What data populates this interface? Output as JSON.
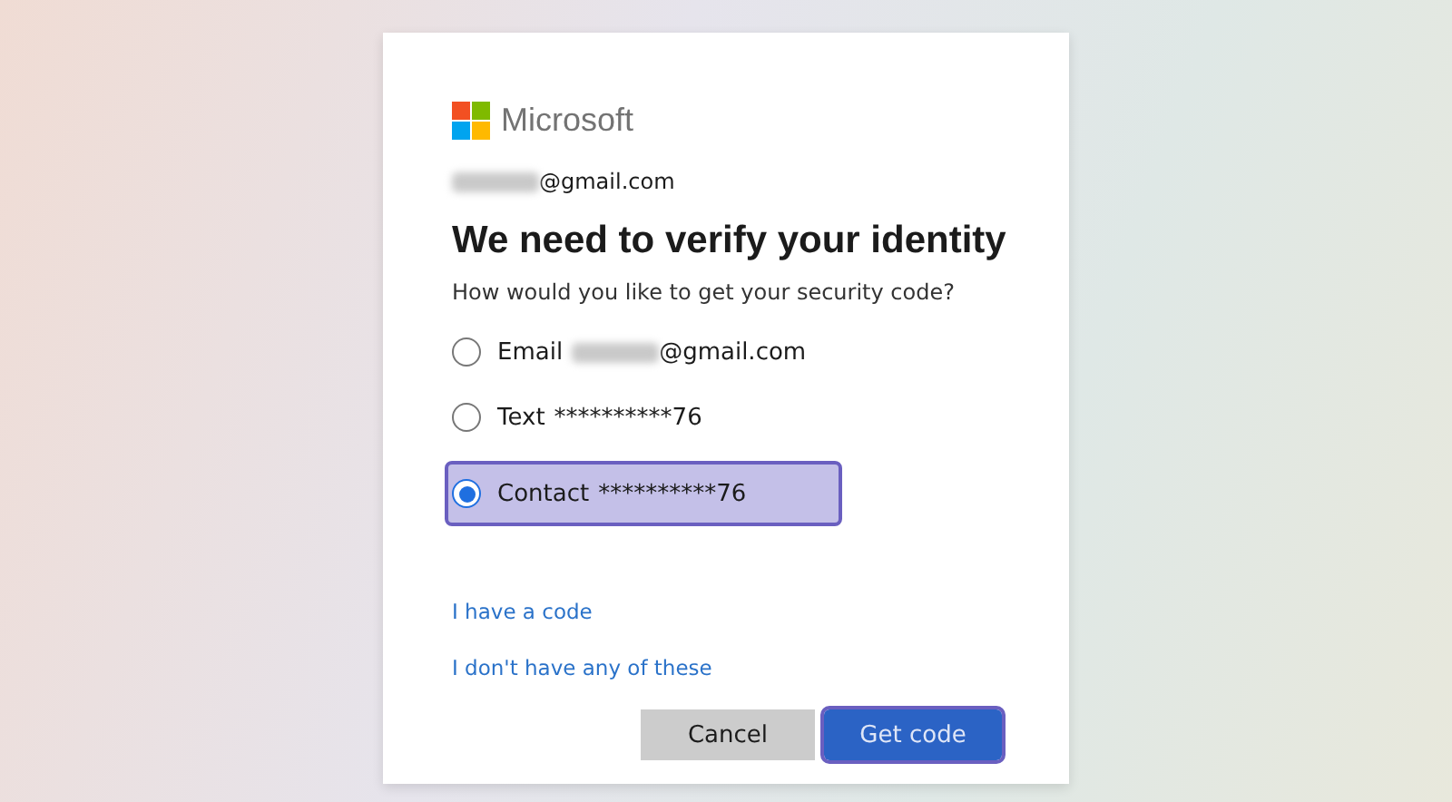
{
  "brand": {
    "name": "Microsoft"
  },
  "account": {
    "redacted": true,
    "suffix": "@gmail.com"
  },
  "title": "We need to verify your identity",
  "prompt": "How would you like to get your security code?",
  "options": [
    {
      "label": "Email",
      "redacted": true,
      "detail": "@gmail.com",
      "selected": false,
      "highlighted": false
    },
    {
      "label": "Text",
      "redacted": false,
      "detail": "**********76",
      "selected": false,
      "highlighted": false
    },
    {
      "label": "Contact",
      "redacted": false,
      "detail": "**********76",
      "selected": true,
      "highlighted": true
    }
  ],
  "links": [
    "I have a code",
    "I don't have any of these"
  ],
  "buttons": [
    {
      "label": "Cancel",
      "kind": "secondary",
      "highlighted": false
    },
    {
      "label": "Get code",
      "kind": "primary",
      "highlighted": true
    }
  ]
}
